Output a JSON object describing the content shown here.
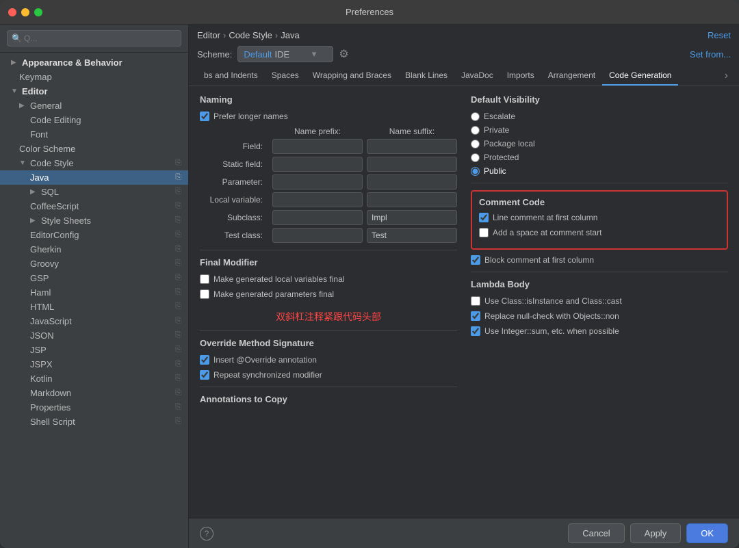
{
  "window": {
    "title": "Preferences"
  },
  "breadcrumb": {
    "parts": [
      "Editor",
      "Code Style",
      "Java"
    ]
  },
  "reset_label": "Reset",
  "scheme": {
    "label": "Scheme:",
    "default_text": "Default",
    "ide_text": "IDE",
    "set_from_label": "Set from..."
  },
  "tabs": [
    {
      "label": "bs and Indents",
      "active": false
    },
    {
      "label": "Spaces",
      "active": false
    },
    {
      "label": "Wrapping and Braces",
      "active": false
    },
    {
      "label": "Blank Lines",
      "active": false
    },
    {
      "label": "JavaDoc",
      "active": false
    },
    {
      "label": "Imports",
      "active": false
    },
    {
      "label": "Arrangement",
      "active": false
    },
    {
      "label": "Code Generation",
      "active": true
    }
  ],
  "naming": {
    "title": "Naming",
    "prefer_longer_names": "Prefer longer names",
    "name_prefix_label": "Name prefix:",
    "name_suffix_label": "Name suffix:",
    "rows": [
      {
        "label": "Field:",
        "prefix": "",
        "suffix": ""
      },
      {
        "label": "Static field:",
        "prefix": "",
        "suffix": ""
      },
      {
        "label": "Parameter:",
        "prefix": "",
        "suffix": ""
      },
      {
        "label": "Local variable:",
        "prefix": "",
        "suffix": ""
      },
      {
        "label": "Subclass:",
        "prefix": "",
        "suffix": "Impl"
      },
      {
        "label": "Test class:",
        "prefix": "",
        "suffix": "Test"
      }
    ]
  },
  "default_visibility": {
    "title": "Default Visibility",
    "options": [
      {
        "label": "Escalate",
        "selected": false
      },
      {
        "label": "Private",
        "selected": false
      },
      {
        "label": "Package local",
        "selected": false
      },
      {
        "label": "Protected",
        "selected": false
      },
      {
        "label": "Public",
        "selected": true
      }
    ]
  },
  "final_modifier": {
    "title": "Final Modifier",
    "annotation_text": "双斜杠注释紧跟代码头部",
    "options": [
      {
        "label": "Make generated local variables final",
        "checked": false
      },
      {
        "label": "Make generated parameters final",
        "checked": false
      }
    ]
  },
  "comment_code": {
    "title": "Comment Code",
    "options": [
      {
        "label": "Line comment at first column",
        "checked": true
      },
      {
        "label": "Add a space at comment start",
        "checked": false
      },
      {
        "label": "Block comment at first column",
        "checked": true
      }
    ]
  },
  "override_method": {
    "title": "Override Method Signature",
    "options": [
      {
        "label": "Insert @Override annotation",
        "checked": true
      },
      {
        "label": "Repeat synchronized modifier",
        "checked": true
      }
    ]
  },
  "annotations_to_copy": {
    "title": "Annotations to Copy"
  },
  "lambda_body": {
    "title": "Lambda Body",
    "options": [
      {
        "label": "Use Class::isInstance and Class::cast",
        "checked": false
      },
      {
        "label": "Replace null-check with Objects::non",
        "checked": true
      },
      {
        "label": "Use Integer::sum, etc. when possible",
        "checked": true
      }
    ]
  },
  "sidebar": {
    "search_placeholder": "Q...",
    "items": [
      {
        "label": "Appearance & Behavior",
        "level": 0,
        "arrow": "▶",
        "bold": true
      },
      {
        "label": "Keymap",
        "level": 1
      },
      {
        "label": "Editor",
        "level": 0,
        "arrow": "▼",
        "bold": true
      },
      {
        "label": "General",
        "level": 1,
        "arrow": "▶"
      },
      {
        "label": "Code Editing",
        "level": 2
      },
      {
        "label": "Font",
        "level": 2
      },
      {
        "label": "Color Scheme",
        "level": 2
      },
      {
        "label": "Code Style",
        "level": 1,
        "arrow": "▼",
        "copy": true
      },
      {
        "label": "Java",
        "level": 2,
        "selected": true,
        "copy": true
      },
      {
        "label": "SQL",
        "level": 2,
        "arrow": "▶",
        "copy": true
      },
      {
        "label": "CoffeeScript",
        "level": 2,
        "copy": true
      },
      {
        "label": "Style Sheets",
        "level": 2,
        "arrow": "▶",
        "copy": true
      },
      {
        "label": "EditorConfig",
        "level": 2,
        "copy": true
      },
      {
        "label": "Gherkin",
        "level": 2,
        "copy": true
      },
      {
        "label": "Groovy",
        "level": 2,
        "copy": true
      },
      {
        "label": "GSP",
        "level": 2,
        "copy": true
      },
      {
        "label": "Haml",
        "level": 2,
        "copy": true
      },
      {
        "label": "HTML",
        "level": 2,
        "copy": true
      },
      {
        "label": "JavaScript",
        "level": 2,
        "copy": true
      },
      {
        "label": "JSON",
        "level": 2,
        "copy": true
      },
      {
        "label": "JSP",
        "level": 2,
        "copy": true
      },
      {
        "label": "JSPX",
        "level": 2,
        "copy": true
      },
      {
        "label": "Kotlin",
        "level": 2,
        "copy": true
      },
      {
        "label": "Markdown",
        "level": 2,
        "copy": true
      },
      {
        "label": "Properties",
        "level": 2,
        "copy": true
      },
      {
        "label": "Shell Script",
        "level": 2,
        "copy": true
      }
    ]
  },
  "buttons": {
    "cancel": "Cancel",
    "apply": "Apply",
    "ok": "OK",
    "help": "?"
  }
}
